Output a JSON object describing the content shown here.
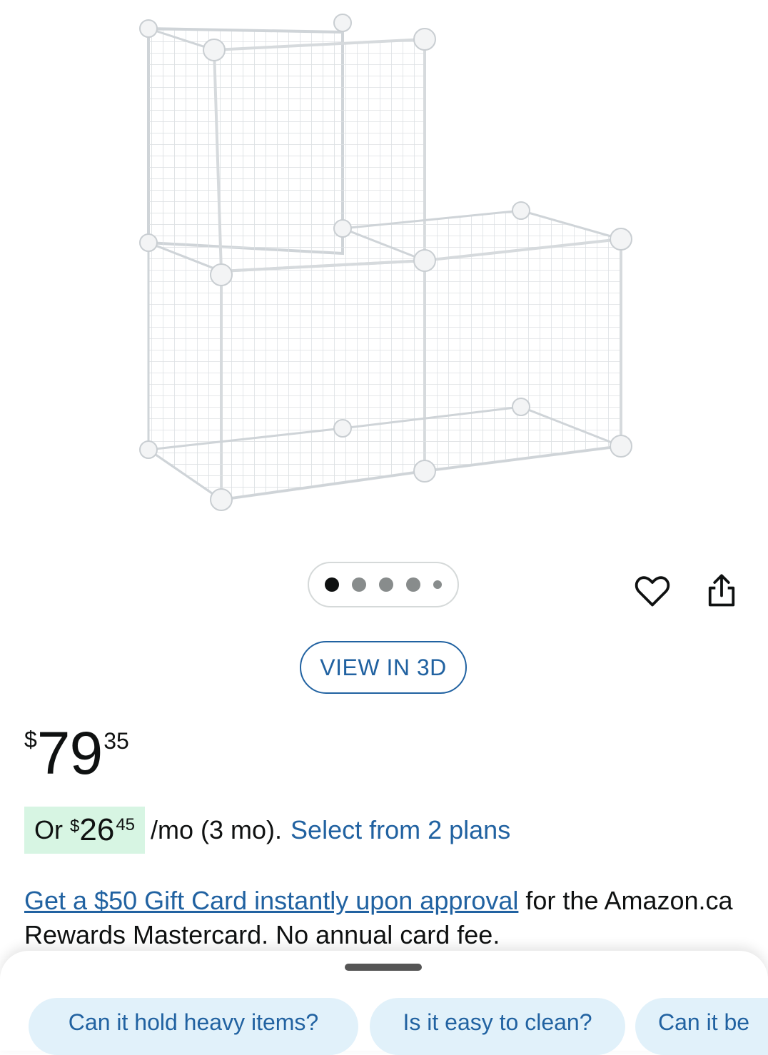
{
  "product": {
    "image_alt": "white wire cube storage organizer"
  },
  "carousel": {
    "total": 5,
    "active": 0
  },
  "actions": {
    "wishlist_icon": "heart-icon",
    "share_icon": "share-icon"
  },
  "view_3d": {
    "label": "VIEW IN 3D"
  },
  "price": {
    "symbol": "$",
    "whole": "79",
    "fraction": "35"
  },
  "installment": {
    "prefix": "Or",
    "symbol": "$",
    "whole": "26",
    "fraction": "45",
    "suffix": "/mo (3 mo).",
    "link": "Select from 2 plans"
  },
  "promo": {
    "link": "Get a $50 Gift Card instantly upon approval",
    "text": " for the Amazon.ca Rewards Mastercard. No annual card fee."
  },
  "questions": [
    {
      "label": "Can it hold heavy items?"
    },
    {
      "label": "Is it easy to clean?"
    },
    {
      "label": "Can it be"
    }
  ],
  "colors": {
    "link": "#2162a1",
    "installment_bg": "#d7f5e3",
    "chip_bg": "#e1f1fa"
  }
}
